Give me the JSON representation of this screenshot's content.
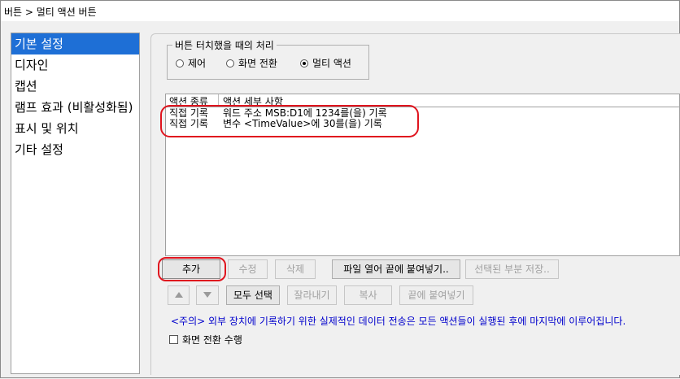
{
  "window": {
    "title": "버튼 > 멀티 액션 버튼"
  },
  "sidebar": {
    "items": [
      {
        "label": "기본 설정",
        "selected": true
      },
      {
        "label": "디자인"
      },
      {
        "label": "캡션"
      },
      {
        "label": "램프 효과 (비활성화됨)"
      },
      {
        "label": "표시 및 위치"
      },
      {
        "label": "기타 설정"
      }
    ]
  },
  "touch_group": {
    "legend": "버튼 터치했을 때의 처리",
    "options": [
      {
        "label": "제어",
        "checked": false
      },
      {
        "label": "화면 전환",
        "checked": false
      },
      {
        "label": "멀티 액션",
        "checked": true
      }
    ]
  },
  "action_list": {
    "columns": [
      "액션 종류",
      "액션 세부 사항"
    ],
    "rows": [
      {
        "type": "직접 기록",
        "detail": "워드 주소 MSB:D1에 1234를(을) 기록"
      },
      {
        "type": "직접 기록",
        "detail": "변수 <TimeValue>에 30를(을) 기록"
      }
    ]
  },
  "buttons": {
    "add": "추가",
    "edit": "수정",
    "delete": "삭제",
    "open_append": "파일 열어 끝에 붙여넣기..",
    "save_selected": "선택된 부분 저장..",
    "select_all": "모두 선택",
    "cut": "잘라내기",
    "copy": "복사",
    "paste_end": "끝에 붙여넣기"
  },
  "notice": "<주의> 외부 장치에 기록하기 위한 실제적인 데이터 전송은 모든 액션들이 실행된 후에 마지막에 이루어집니다.",
  "screen_change_checkbox": {
    "label": "화면 전환 수행",
    "checked": false
  },
  "colors": {
    "selection": "#1e6fd6",
    "highlight": "#e0141e",
    "notice": "#0000cc"
  }
}
